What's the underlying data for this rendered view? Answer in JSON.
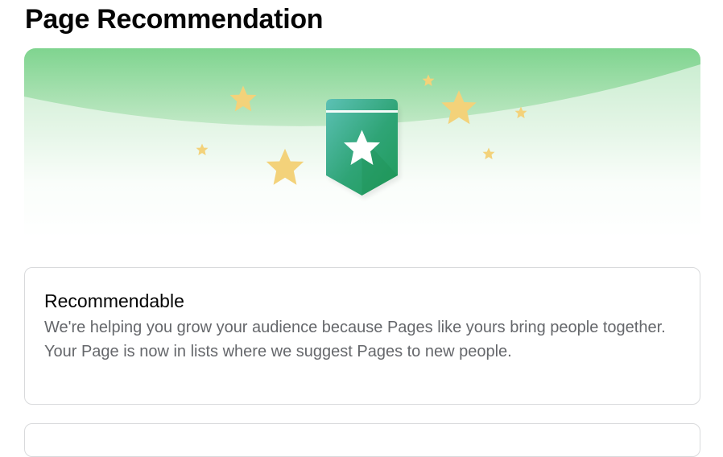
{
  "page": {
    "title": "Page Recommendation"
  },
  "banner": {
    "icon": "recommendation-badge-star-icon",
    "decoration": "star-icons",
    "colors": {
      "gradient_top": "#7fd48f",
      "badge_dark": "#1f9b5a",
      "badge_light": "#4fb9a6",
      "star": "#f3d27a"
    }
  },
  "status_card": {
    "title": "Recommendable",
    "description": "We're helping you grow your audience because Pages like yours bring people together. Your Page is now in lists where we suggest Pages to new people."
  }
}
